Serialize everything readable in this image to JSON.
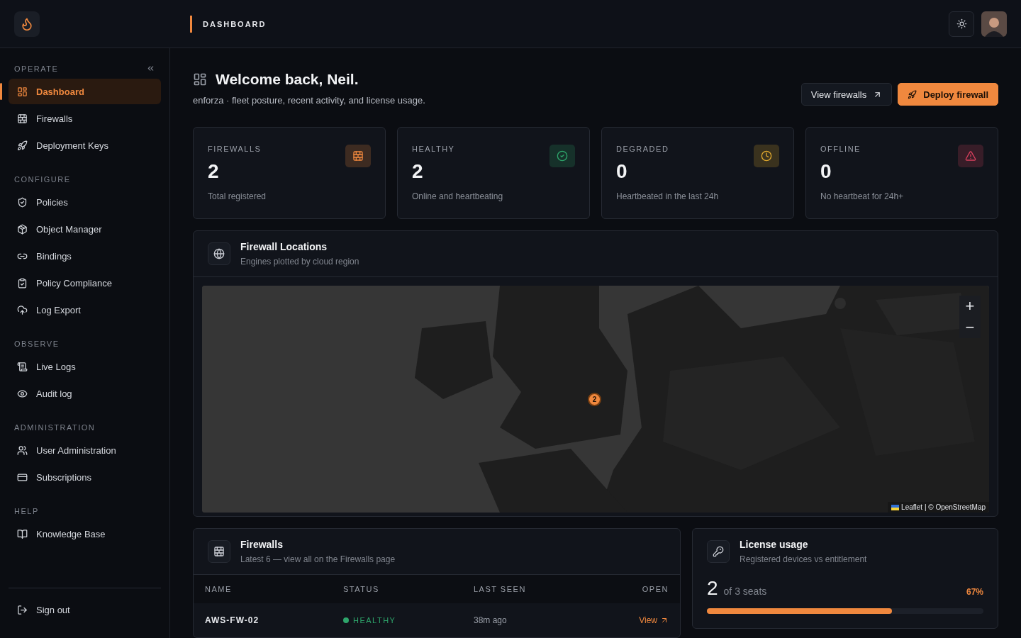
{
  "header": {
    "title": "DASHBOARD"
  },
  "sidebar": {
    "sections": [
      {
        "title": "OPERATE",
        "items": [
          {
            "label": "Dashboard",
            "kind": "dashboard",
            "selected": true
          },
          {
            "label": "Firewalls",
            "kind": "wall",
            "selected": false
          },
          {
            "label": "Deployment Keys",
            "kind": "rocket",
            "selected": false
          }
        ]
      },
      {
        "title": "CONFIGURE",
        "items": [
          {
            "label": "Policies",
            "kind": "shield",
            "selected": false
          },
          {
            "label": "Object Manager",
            "kind": "package",
            "selected": false
          },
          {
            "label": "Bindings",
            "kind": "link",
            "selected": false
          },
          {
            "label": "Policy Compliance",
            "kind": "clipboard",
            "selected": false
          },
          {
            "label": "Log Export",
            "kind": "cloud",
            "selected": false
          }
        ]
      },
      {
        "title": "OBSERVE",
        "items": [
          {
            "label": "Live Logs",
            "kind": "scroll",
            "selected": false
          },
          {
            "label": "Audit log",
            "kind": "eye",
            "selected": false
          }
        ]
      },
      {
        "title": "ADMINISTRATION",
        "items": [
          {
            "label": "User Administration",
            "kind": "users",
            "selected": false
          },
          {
            "label": "Subscriptions",
            "kind": "card",
            "selected": false
          }
        ]
      },
      {
        "title": "HELP",
        "items": [
          {
            "label": "Knowledge Base",
            "kind": "book",
            "selected": false
          }
        ]
      }
    ],
    "sign_out": "Sign out"
  },
  "page": {
    "title": "Welcome back, Neil.",
    "subtitle": "enforza · fleet posture, recent activity, and license usage.",
    "buttons": [
      {
        "label": "View firewalls",
        "kind": "secondary"
      },
      {
        "label": "Deploy firewall",
        "kind": "primary"
      }
    ]
  },
  "stats": [
    {
      "label": "FIREWALLS",
      "value": "2",
      "caption": "Total registered",
      "kind": "wall",
      "color": "#f0883e"
    },
    {
      "label": "HEALTHY",
      "value": "2",
      "caption": "Online and heartbeating",
      "kind": "check",
      "color": "#2ea56b"
    },
    {
      "label": "DEGRADED",
      "value": "0",
      "caption": "Heartbeated in the last 24h",
      "kind": "clock",
      "color": "#e0a82e"
    },
    {
      "label": "OFFLINE",
      "value": "0",
      "caption": "No heartbeat for 24h+",
      "kind": "alert",
      "color": "#d9405e"
    }
  ],
  "map_card": {
    "title": "Firewall Locations",
    "subtitle": "Engines plotted by cloud region",
    "map": {
      "kind": "picture",
      "cluster_count": "2",
      "zoom_in": "+",
      "zoom_out": "−",
      "attribution": "Leaflet | © OpenStreetMap"
    }
  },
  "firewalls_card": {
    "title": "Firewalls",
    "subtitle": "Latest 6 — view all on the Firewalls page",
    "columns": [
      "NAME",
      "STATUS",
      "LAST SEEN",
      "OPEN"
    ],
    "rows": [
      {
        "name": "AWS-FW-02",
        "status": "HEALTHY",
        "last_seen": "38m ago",
        "open": "View"
      }
    ]
  },
  "license_card": {
    "title": "License usage",
    "subtitle": "Registered devices vs entitlement",
    "used": "2",
    "of": "of 3 seats",
    "percent": "67%",
    "level": 0.67
  }
}
